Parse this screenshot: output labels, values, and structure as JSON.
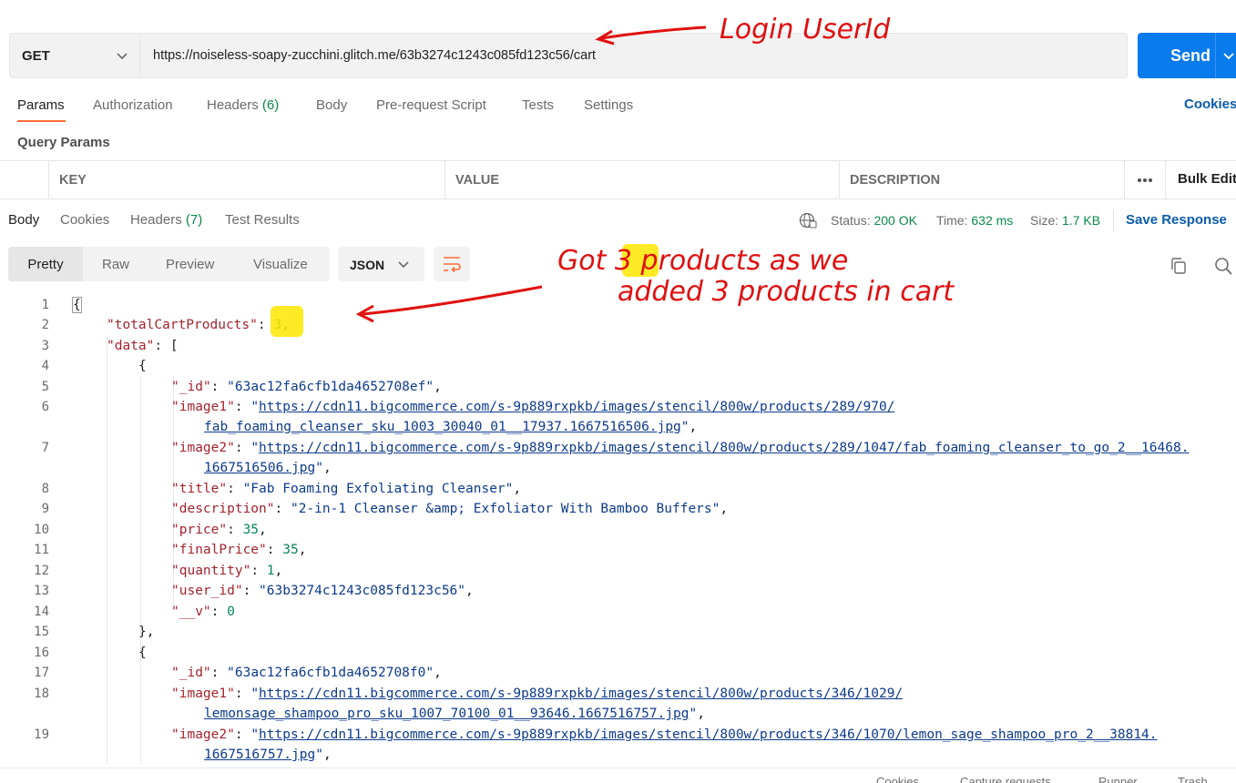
{
  "request": {
    "method": "GET",
    "url": "https://noiseless-soapy-zucchini.glitch.me/63b3274c1243c085fd123c56/cart",
    "send_label": "Send"
  },
  "request_tabs": {
    "params": "Params",
    "authorization": "Authorization",
    "headers": "Headers",
    "headers_count": "(6)",
    "body": "Body",
    "prerequest": "Pre-request Script",
    "tests": "Tests",
    "settings": "Settings",
    "cookies": "Cookies"
  },
  "query_params": {
    "title": "Query Params",
    "col_key": "KEY",
    "col_value": "VALUE",
    "col_description": "DESCRIPTION",
    "bulk_edit": "Bulk Edit"
  },
  "response_tabs": {
    "body": "Body",
    "cookies": "Cookies",
    "headers": "Headers",
    "headers_count": "(7)",
    "test_results": "Test Results"
  },
  "response_meta": {
    "status_label": "Status:",
    "status_value": "200 OK",
    "time_label": "Time:",
    "time_value": "632 ms",
    "size_label": "Size:",
    "size_value": "1.7 KB",
    "save_response": "Save Response"
  },
  "view_modes": {
    "pretty": "Pretty",
    "raw": "Raw",
    "preview": "Preview",
    "visualize": "Visualize",
    "format": "JSON"
  },
  "code": {
    "line_numbers": [
      "1",
      "2",
      "3",
      "4",
      "5",
      "6",
      "",
      "7",
      "",
      "8",
      "9",
      "10",
      "11",
      "12",
      "13",
      "14",
      "15",
      "16",
      "17",
      "18",
      "",
      "19",
      ""
    ],
    "total_key": "\"totalCartProducts\"",
    "total_value": "3",
    "data_key": "\"data\"",
    "item1": {
      "id": "\"63ac12fa6cfb1da4652708ef\"",
      "image1_a": "https://cdn11.bigcommerce.com/s-9p889rxpkb/images/stencil/800w/products/289/970/",
      "image1_b": "fab_foaming_cleanser_sku_1003_30040_01__17937.1667516506.jpg",
      "image2_a": "https://cdn11.bigcommerce.com/s-9p889rxpkb/images/stencil/800w/products/289/1047/fab_foaming_cleanser_to_go_2__16468.",
      "image2_b": "1667516506.jpg",
      "title": "\"Fab Foaming Exfoliating Cleanser\"",
      "description": "\"2-in-1 Cleanser &amp; Exfoliator With Bamboo Buffers\"",
      "price": "35",
      "final_price": "35",
      "quantity": "1",
      "user_id": "\"63b3274c1243c085fd123c56\"",
      "v": "0"
    },
    "item2": {
      "id": "\"63ac12fa6cfb1da4652708f0\"",
      "image1_a": "https://cdn11.bigcommerce.com/s-9p889rxpkb/images/stencil/800w/products/346/1029/",
      "image1_b": "lemonsage_shampoo_pro_sku_1007_70100_01__93646.1667516757.jpg",
      "image2_a": "https://cdn11.bigcommerce.com/s-9p889rxpkb/images/stencil/800w/products/346/1070/lemon_sage_shampoo_pro_2__38814.",
      "image2_b": "1667516757.jpg"
    },
    "keys": {
      "id": "\"_id\"",
      "image1": "\"image1\"",
      "image2": "\"image2\"",
      "title": "\"title\"",
      "description": "\"description\"",
      "price": "\"price\"",
      "final_price": "\"finalPrice\"",
      "quantity": "\"quantity\"",
      "user_id": "\"user_id\"",
      "v": "\"__v\""
    }
  },
  "footer": {
    "cookies": "Cookies",
    "capture": "Capture requests",
    "runner": "Runner",
    "trash": "Trash"
  },
  "annotations": {
    "login_user_id": "Login UserId",
    "got_products_1": "Got 3 products as we",
    "got_products_2": "added 3 products in cart"
  },
  "colors": {
    "accent": "#ff6c37",
    "send": "#097bed",
    "link": "#0b5cad",
    "success": "#0a8a4a",
    "annotation": "#e01010",
    "highlight": "#ffe600"
  }
}
